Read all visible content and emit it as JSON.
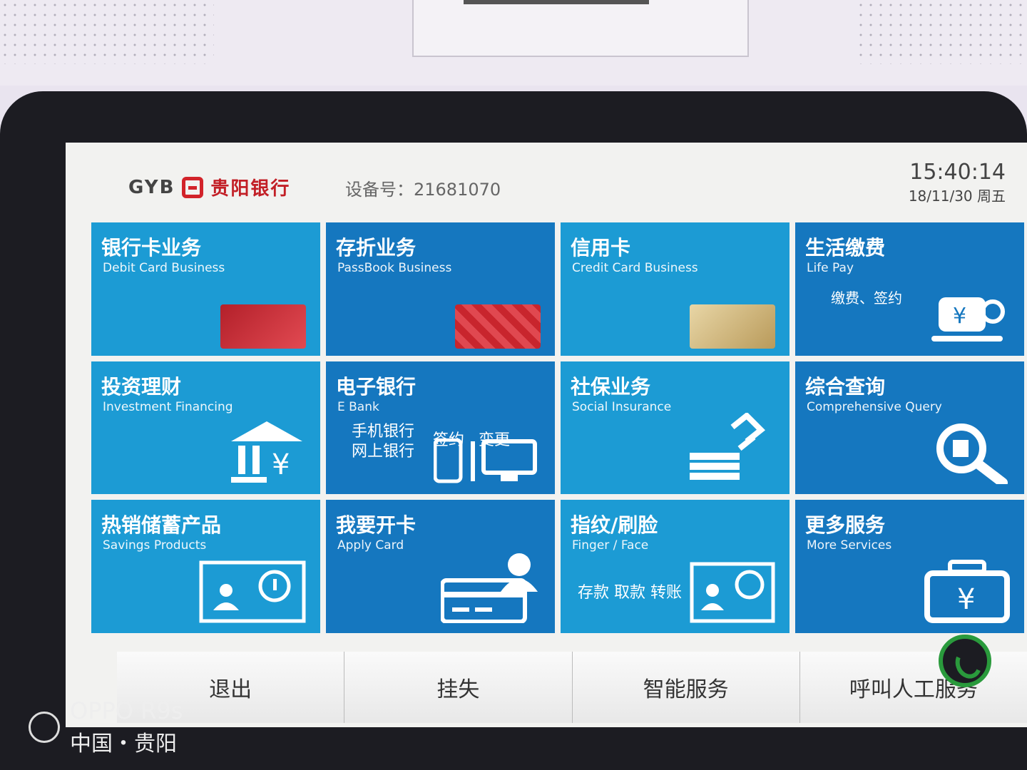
{
  "header": {
    "logo_latin": "GYB",
    "logo_cn": "贵阳银行",
    "device_label": "设备号：21681070",
    "time": "15:40:14",
    "date": "18/11/30 周五"
  },
  "tiles": [
    {
      "cn": "银行卡业务",
      "en": "Debit Card Business"
    },
    {
      "cn": "存折业务",
      "en": "PassBook Business"
    },
    {
      "cn": "信用卡",
      "en": "Credit Card Business"
    },
    {
      "cn": "生活缴费",
      "en": "Life Pay",
      "extra": "缴费、签约"
    },
    {
      "cn": "投资理财",
      "en": "Investment Financing"
    },
    {
      "cn": "电子银行",
      "en": "E Bank",
      "extra1": "手机银行",
      "extra2": "网上银行",
      "extra3": "签约",
      "extra4": "变更"
    },
    {
      "cn": "社保业务",
      "en": "Social Insurance"
    },
    {
      "cn": "综合查询",
      "en": "Comprehensive Query"
    },
    {
      "cn": "热销储蓄产品",
      "en": "Savings Products"
    },
    {
      "cn": "我要开卡",
      "en": "Apply Card"
    },
    {
      "cn": "指纹/刷脸",
      "en": "Finger / Face",
      "extra": "存款 取款 转账"
    },
    {
      "cn": "更多服务",
      "en": "More Services"
    }
  ],
  "bottom_buttons": [
    "退出",
    "挂失",
    "智能服务",
    "呼叫人工服务"
  ],
  "watermark": {
    "model": "OPPO R9s",
    "location": "中国・贵阳"
  },
  "colors": {
    "tile_light": "#1c9bd4",
    "tile_dark": "#1577bf",
    "brand_red": "#c21f26"
  }
}
